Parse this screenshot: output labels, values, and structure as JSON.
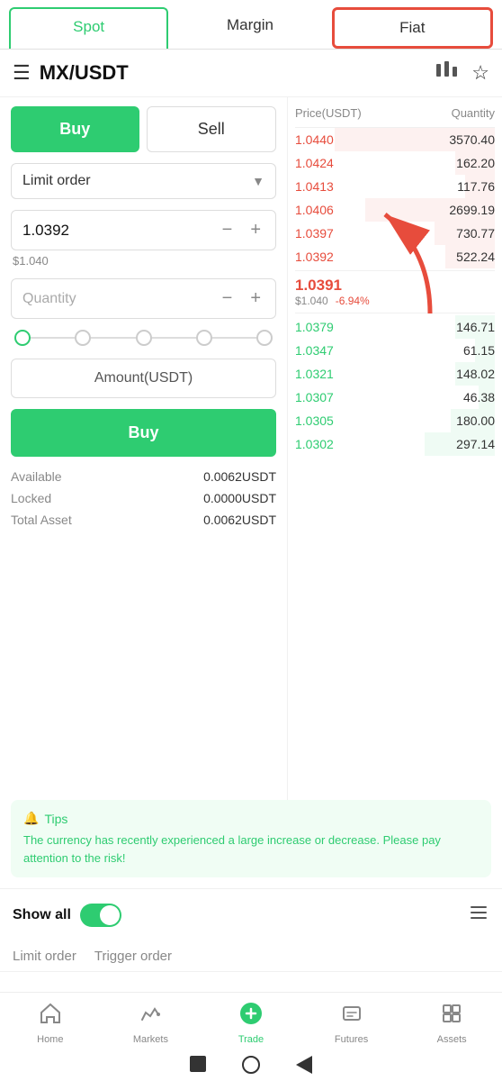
{
  "tabs": {
    "spot": "Spot",
    "margin": "Margin",
    "fiat": "Fiat"
  },
  "header": {
    "pair": "MX/USDT"
  },
  "buySell": {
    "buy": "Buy",
    "sell": "Sell"
  },
  "orderType": {
    "label": "Limit order"
  },
  "priceInput": {
    "value": "1.0392",
    "usdValue": "$1.040"
  },
  "quantityInput": {
    "placeholder": "Quantity"
  },
  "amountButton": {
    "label": "Amount(USDT)"
  },
  "buyButton": {
    "label": "Buy"
  },
  "assets": {
    "available": {
      "label": "Available",
      "value": "0.0062USDT"
    },
    "locked": {
      "label": "Locked",
      "value": "0.0000USDT"
    },
    "totalAsset": {
      "label": "Total Asset",
      "value": "0.0062USDT"
    }
  },
  "orderBook": {
    "priceLabel": "Price(USDT)",
    "quantityLabel": "Quantity",
    "sellOrders": [
      {
        "price": "1.0440",
        "qty": "3570.40",
        "bgWidth": "80"
      },
      {
        "price": "1.0424",
        "qty": "162.20",
        "bgWidth": "20"
      },
      {
        "price": "1.0413",
        "qty": "117.76",
        "bgWidth": "15"
      },
      {
        "price": "1.0406",
        "qty": "2699.19",
        "bgWidth": "65"
      },
      {
        "price": "1.0397",
        "qty": "730.77",
        "bgWidth": "30"
      },
      {
        "price": "1.0392",
        "qty": "522.24",
        "bgWidth": "25"
      }
    ],
    "currentPrice": "1.0391",
    "currentUSD": "$1.040",
    "currentChange": "-6.94%",
    "buyOrders": [
      {
        "price": "1.0379",
        "qty": "146.71",
        "bgWidth": "20"
      },
      {
        "price": "1.0347",
        "qty": "61.15",
        "bgWidth": "10"
      },
      {
        "price": "1.0321",
        "qty": "148.02",
        "bgWidth": "20"
      },
      {
        "price": "1.0307",
        "qty": "46.38",
        "bgWidth": "8"
      },
      {
        "price": "1.0305",
        "qty": "180.00",
        "bgWidth": "22"
      },
      {
        "price": "1.0302",
        "qty": "297.14",
        "bgWidth": "35"
      }
    ]
  },
  "tips": {
    "icon": "🔔",
    "title": "Tips",
    "text": "The currency has recently experienced a large increase or decrease. Please pay attention to the risk!"
  },
  "showAll": {
    "label": "Show all"
  },
  "orderTabs": {
    "limitOrder": "Limit order",
    "triggerOrder": "Trigger order"
  },
  "bottomNav": {
    "home": "Home",
    "markets": "Markets",
    "trade": "Trade",
    "futures": "Futures",
    "assets": "Assets"
  },
  "sliderDots": [
    "0%",
    "25%",
    "50%",
    "75%",
    "100%"
  ]
}
